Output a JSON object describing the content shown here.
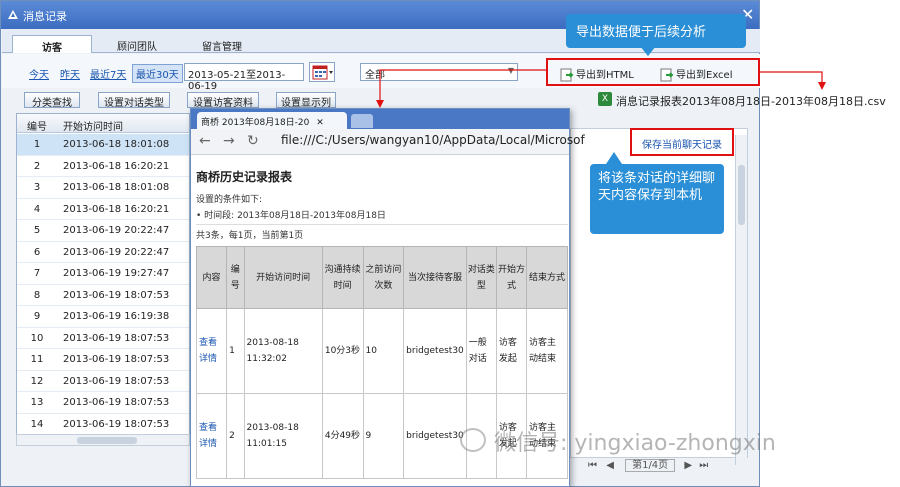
{
  "window": {
    "title": "消息记录"
  },
  "tabs": [
    {
      "label": "访客"
    },
    {
      "label": "顾问团队"
    },
    {
      "label": "留言管理"
    }
  ],
  "filters": {
    "today": "今天",
    "yesterday": "昨天",
    "last7": "最近7天",
    "last30": "最近30天",
    "date_range": "2013-05-21至2013-06-19",
    "select_value": "全部"
  },
  "export": {
    "html_label": "导出到HTML",
    "excel_label": "导出到Excel",
    "csv_file": "消息记录报表2013年08月18日-2013年08月18日.csv"
  },
  "toolbar": {
    "btn1": "分类查找",
    "btn2": "设置对话类型",
    "btn3": "设置访客资料",
    "btn4": "设置显示列"
  },
  "table": {
    "headers": [
      "编号",
      "开始访问时间"
    ],
    "rows": [
      {
        "num": "1",
        "time": "2013-06-18 18:01:08"
      },
      {
        "num": "2",
        "time": "2013-06-18 16:20:21"
      },
      {
        "num": "3",
        "time": "2013-06-18 18:01:08"
      },
      {
        "num": "4",
        "time": "2013-06-18 16:20:21"
      },
      {
        "num": "5",
        "time": "2013-06-19 20:22:47"
      },
      {
        "num": "6",
        "time": "2013-06-19 20:22:47"
      },
      {
        "num": "7",
        "time": "2013-06-19 19:27:47"
      },
      {
        "num": "8",
        "time": "2013-06-19 18:07:53"
      },
      {
        "num": "9",
        "time": "2013-06-19 16:19:38"
      },
      {
        "num": "10",
        "time": "2013-06-19 18:07:53"
      },
      {
        "num": "11",
        "time": "2013-06-19 18:07:53"
      },
      {
        "num": "12",
        "time": "2013-06-19 18:07:53"
      },
      {
        "num": "13",
        "time": "2013-06-19 18:07:53"
      },
      {
        "num": "14",
        "time": "2013-06-19 18:07:53"
      }
    ]
  },
  "save_link": "保存当前聊天记录",
  "pager": {
    "page": "第1/4页"
  },
  "browser": {
    "tab_title": "商桥 2013年08月18日-20",
    "url": "file:///C:/Users/wangyan10/AppData/Local/Microsof",
    "report_title": "商桥历史记录报表",
    "cond_label": "设置的条件如下:",
    "period": "时间段: 2013年08月18日-2013年08月18日",
    "summary": "共3条，每1页，当前第1页",
    "headers": [
      "内容",
      "编号",
      "开始访问时间",
      "沟通持续时间",
      "之前访问次数",
      "当次接待客服",
      "对话类型",
      "开始方式",
      "结束方式"
    ],
    "rows": [
      {
        "content": "查看详情",
        "num": "1",
        "time": "2013-08-18 11:32:02",
        "duration": "10分3秒",
        "visits": "10",
        "agent": "bridgetest30",
        "type": "一般对话",
        "start": "访客发起",
        "end": "访客主动结束"
      },
      {
        "content": "查看详情",
        "num": "2",
        "time": "2013-08-18 11:01:15",
        "duration": "4分49秒",
        "visits": "9",
        "agent": "bridgetest30",
        "type": "",
        "start": "访客发起",
        "end": "访客主动结束"
      }
    ]
  },
  "callouts": {
    "export_tip": "导出数据便于后续分析",
    "save_tip": "将该条对话的详细聊天内容保存到本机"
  },
  "watermark": "微信号: yingxiao-zhongxin",
  "colors": {
    "accent": "#2a8fd6",
    "highlight": "#e01010",
    "titlebar": "#3c6cc0"
  }
}
